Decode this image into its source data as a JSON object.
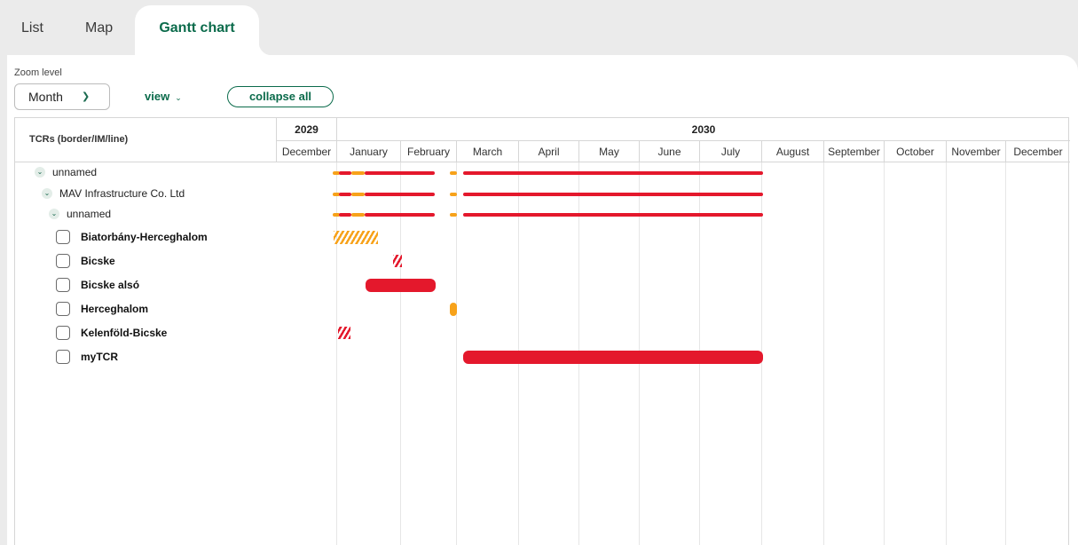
{
  "tabs": [
    {
      "label": "List"
    },
    {
      "label": "Map"
    },
    {
      "label": "Gantt chart"
    }
  ],
  "toolbar": {
    "zoom_label": "Zoom level",
    "zoom_value": "Month",
    "view_label": "view",
    "collapse_label": "collapse all"
  },
  "gantt": {
    "left_header": "TCRs (border/IM/line)",
    "years": [
      "2029",
      "2030"
    ],
    "months": [
      "December",
      "January",
      "February",
      "March",
      "April",
      "May",
      "June",
      "July",
      "August",
      "September",
      "October",
      "November",
      "December"
    ],
    "rows": [
      {
        "label": "unnamed",
        "kind": "group"
      },
      {
        "label": "MAV Infrastructure Co. Ltd",
        "kind": "group"
      },
      {
        "label": "unnamed",
        "kind": "group"
      },
      {
        "label": "Biatorbány-Herceghalom",
        "kind": "item"
      },
      {
        "label": "Bicske",
        "kind": "item"
      },
      {
        "label": "Bicske alsó",
        "kind": "item"
      },
      {
        "label": "Herceghalom",
        "kind": "item"
      },
      {
        "label": "Kelenföld-Bicske",
        "kind": "item"
      },
      {
        "label": "myTCR",
        "kind": "item"
      }
    ]
  },
  "colors": {
    "accent": "#0b6b4b",
    "bar_red": "#e4182c",
    "bar_orange": "#f7a21a"
  }
}
